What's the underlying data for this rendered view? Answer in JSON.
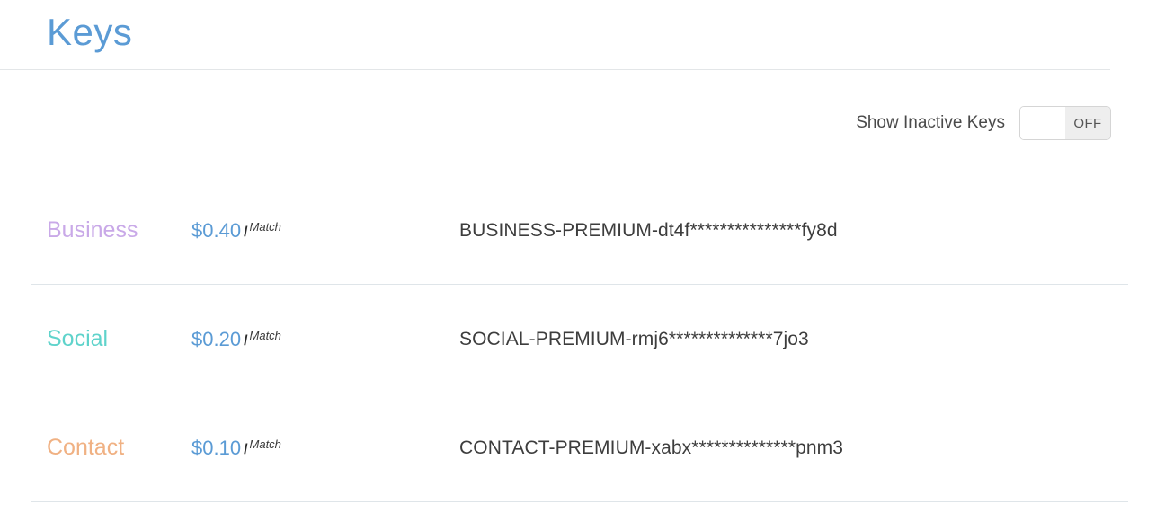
{
  "header": {
    "title": "Keys"
  },
  "toolbar": {
    "toggle_label": "Show Inactive Keys",
    "toggle_state": "OFF"
  },
  "colors": {
    "title": "#5b9bd5",
    "price": "#5b9bd5",
    "business": "#c9a9e8",
    "social": "#5fd3cb",
    "contact": "#f0b183",
    "divider": "#dfe5e9"
  },
  "keys": [
    {
      "name": "Business",
      "color": "#c9a9e8",
      "price": "$0.40",
      "separator": "/",
      "unit": "Match",
      "key": "BUSINESS-PREMIUM-dt4f***************fy8d"
    },
    {
      "name": "Social",
      "color": "#5fd3cb",
      "price": "$0.20",
      "separator": "/",
      "unit": "Match",
      "key": "SOCIAL-PREMIUM-rmj6**************7jo3"
    },
    {
      "name": "Contact",
      "color": "#f0b183",
      "price": "$0.10",
      "separator": "/",
      "unit": "Match",
      "key": "CONTACT-PREMIUM-xabx**************pnm3"
    }
  ]
}
